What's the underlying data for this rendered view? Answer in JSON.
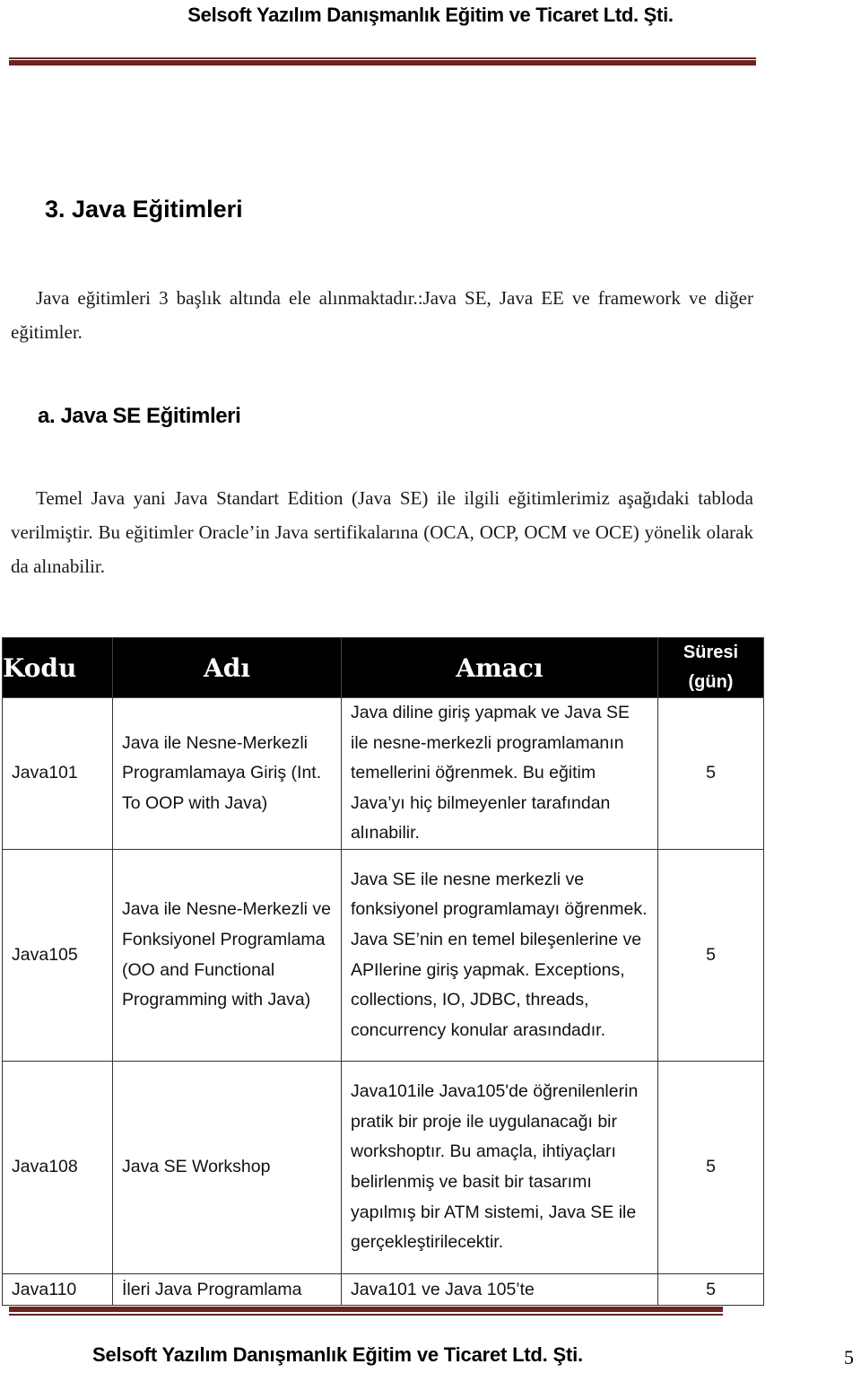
{
  "header": {
    "company": "Selsoft Yazılım Danışmanlık Eğitim ve Ticaret Ltd. Şti."
  },
  "section": {
    "heading": "3. Java Eğitimleri",
    "intro": "Java eğitimleri 3 başlık altında ele alınmaktadır.:Java SE, Java EE ve framework ve diğer eğitimler.",
    "subsection_heading": "a. Java SE Eğitimleri",
    "subsection_text": "Temel Java yani Java Standart Edition (Java SE) ile ilgili eğitimlerimiz aşağıdaki tabloda verilmiştir. Bu eğitimler Oracle’in Java sertifikalarına (OCA, OCP, OCM ve OCE) yönelik olarak da alınabilir."
  },
  "table": {
    "columns": [
      "Kodu",
      "Adı",
      "Amacı",
      "Süresi (gün)"
    ],
    "duration_header_line1": "Süresi",
    "duration_header_line2": "(gün)",
    "rows": [
      {
        "code": "Java101",
        "name": "Java ile Nesne-Merkezli Programlamaya Giriş (Int. To OOP with Java)",
        "purpose": "Java diline giriş yapmak ve Java SE ile nesne-merkezli programlamanın temellerini öğrenmek. Bu eğitim Java’yı hiç bilmeyenler tarafından alınabilir.",
        "duration": "5"
      },
      {
        "code": "Java105",
        "name": "Java ile Nesne-Merkezli ve Fonksiyonel Programlama (OO and Functional Programming with Java)",
        "purpose": "Java SE ile nesne merkezli ve fonksiyonel programlamayı öğrenmek. Java SE’nin en temel bileşenlerine ve APIlerine giriş yapmak. Exceptions, collections, IO, JDBC, threads, concurrency konular arasındadır.",
        "duration": "5"
      },
      {
        "code": "Java108",
        "name": "Java SE Workshop",
        "purpose": "Java101ile Java105'de öğrenilenlerin pratik bir proje ile uygulanacağı bir workshoptır. Bu amaçla, ihtiyaçları belirlenmiş ve basit bir tasarımı yapılmış bir ATM sistemi, Java SE ile gerçekleştirilecektir.",
        "duration": "5"
      },
      {
        "code": "Java110",
        "name": "İleri Java Programlama",
        "purpose": "Java101 ve Java 105’te",
        "duration": "5"
      }
    ]
  },
  "footer": {
    "company": "Selsoft Yazılım Danışmanlık Eğitim ve Ticaret Ltd. Şti.",
    "page_number": "5"
  },
  "colors": {
    "rule": "#6b2424",
    "table_header_bg": "#000000",
    "table_header_text": "#ffffff"
  }
}
